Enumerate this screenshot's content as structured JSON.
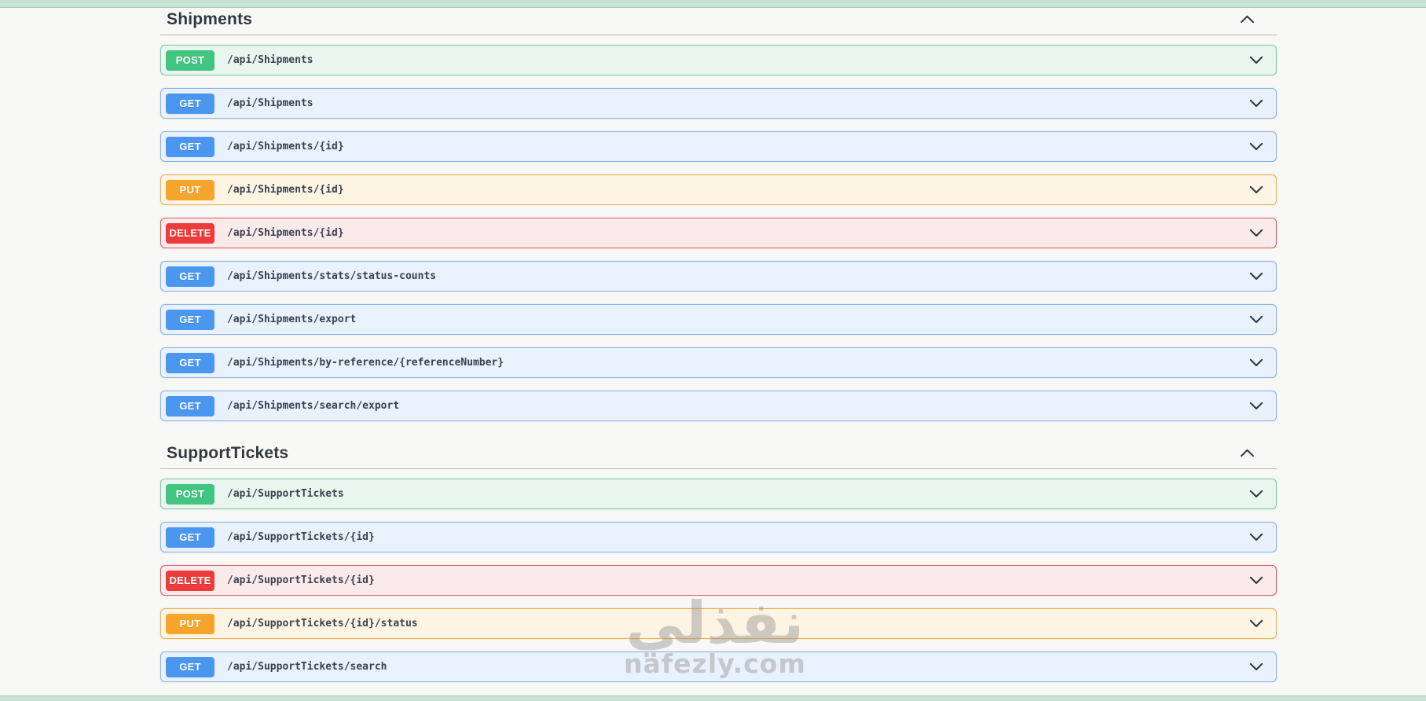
{
  "page": {
    "background": "#f8f8f6",
    "frame_color": "#c9e4d6"
  },
  "watermark": {
    "arabic_text": "نفذلي",
    "domain_text": "nafezly.com"
  },
  "methods": {
    "post": {
      "label": "POST",
      "badge_color": "#41c581",
      "row_bg": "#e9f6ef",
      "border_color": "#74cfa4"
    },
    "get": {
      "label": "GET",
      "badge_color": "#4b97f0",
      "row_bg": "#e9f1fc",
      "border_color": "#84b3ea"
    },
    "put": {
      "label": "PUT",
      "badge_color": "#f5a52b",
      "row_bg": "#fdf4e3",
      "border_color": "#f0ae47"
    },
    "delete": {
      "label": "DELETE",
      "badge_color": "#ee3b3b",
      "row_bg": "#fbeaea",
      "border_color": "#e25b5b"
    }
  },
  "sections": [
    {
      "title": "Shipments",
      "endpoints": [
        {
          "method": "post",
          "path": "/api/Shipments"
        },
        {
          "method": "get",
          "path": "/api/Shipments"
        },
        {
          "method": "get",
          "path": "/api/Shipments/{id}"
        },
        {
          "method": "put",
          "path": "/api/Shipments/{id}"
        },
        {
          "method": "delete",
          "path": "/api/Shipments/{id}"
        },
        {
          "method": "get",
          "path": "/api/Shipments/stats/status-counts"
        },
        {
          "method": "get",
          "path": "/api/Shipments/export"
        },
        {
          "method": "get",
          "path": "/api/Shipments/by-reference/{referenceNumber}"
        },
        {
          "method": "get",
          "path": "/api/Shipments/search/export"
        }
      ]
    },
    {
      "title": "SupportTickets",
      "endpoints": [
        {
          "method": "post",
          "path": "/api/SupportTickets"
        },
        {
          "method": "get",
          "path": "/api/SupportTickets/{id}"
        },
        {
          "method": "delete",
          "path": "/api/SupportTickets/{id}"
        },
        {
          "method": "put",
          "path": "/api/SupportTickets/{id}/status"
        },
        {
          "method": "get",
          "path": "/api/SupportTickets/search"
        }
      ]
    }
  ]
}
